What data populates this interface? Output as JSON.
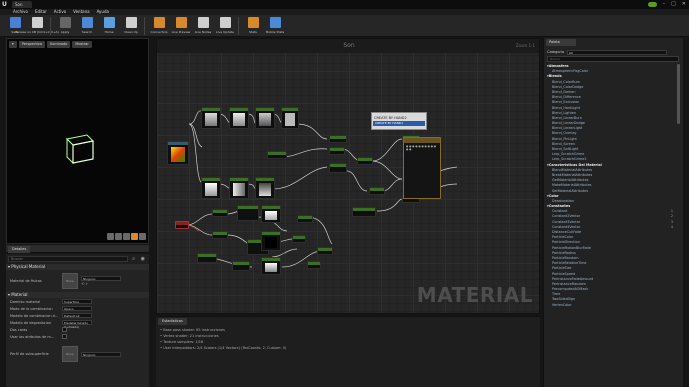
{
  "titlebar": {
    "tab": "Son"
  },
  "menu": [
    "Archivo",
    "Editar",
    "Activo",
    "Ventana",
    "Ayuda"
  ],
  "toolbar": [
    {
      "label": "Save",
      "color": "#4a7fd8",
      "active": false
    },
    {
      "label": "Browse on CB (Cmd+Ctrl+A)",
      "color": "#cfcfcf",
      "active": false
    },
    {
      "label": "Apply",
      "color": "#666666",
      "active": false
    },
    {
      "label": "Search",
      "color": "#4a8ad8",
      "active": false
    },
    {
      "label": "Home",
      "color": "#5aa0e0",
      "active": false
    },
    {
      "label": "Clean Up",
      "color": "#cfcfcf",
      "active": false
    },
    {
      "label": "Connectors",
      "color": "#d88a2a",
      "active": true
    },
    {
      "label": "Live Preview",
      "color": "#d88a2a",
      "active": true
    },
    {
      "label": "Live Nodes",
      "color": "#cfcfcf",
      "active": false
    },
    {
      "label": "Live Update",
      "color": "#cfcfcf",
      "active": false
    },
    {
      "label": "Stats",
      "color": "#d88a2a",
      "active": true
    },
    {
      "label": "Mobile Stats",
      "color": "#4a8ad8",
      "active": false
    }
  ],
  "viewport": {
    "buttons": [
      "Perspectiva",
      "Iluminado",
      "Mostrar"
    ]
  },
  "details": {
    "tab": "Detalles",
    "search_placeholder": "Buscar",
    "physical_section": "Physical Material",
    "phys_label": "Material de fisicas",
    "phys_thumb": "None",
    "phys_value": "Ninguno",
    "material_section": "Material",
    "rows": [
      {
        "label": "Dominio material",
        "value": "Superficie",
        "type": "dropdown"
      },
      {
        "label": "Modo de la combinacion",
        "value": "Opaco",
        "type": "dropdown"
      },
      {
        "label": "Modelo de combinacion d...",
        "value": "Default Lit",
        "type": "dropdown"
      },
      {
        "label": "Modelo de degradacion",
        "value": "Predeterminado (Lumiado)",
        "type": "dropdown"
      },
      {
        "label": "Dos caras",
        "value": "",
        "type": "checkbox"
      },
      {
        "label": "Usar los atributos de m...",
        "value": "",
        "type": "checkbox"
      }
    ],
    "subsurface_label": "Perfil de subsuperficie",
    "subsurface_thumb": "None",
    "subsurface_value": "Ninguno"
  },
  "graph": {
    "title": "Son",
    "zoom": "Zoom 1:1",
    "watermark": "MATERIAL"
  },
  "context_menu": {
    "item": "CREATE BY HAND2",
    "highlight": "CREATE BY HAND1"
  },
  "stats": {
    "tab": "Estadisticas",
    "lines": [
      "Base pass shader: 65 instrucciones",
      "Vertex shader: 21 instrucciones",
      "Texture samplers: 1/16",
      "User interpolators: 2/4 Scalars (1/4 Vectors) (TexCoords: 2, Custom: 0)"
    ]
  },
  "palette": {
    "tab": "Paleta",
    "category_label": "Categoria",
    "category_value": "All",
    "search_placeholder": "Buscar",
    "items": [
      {
        "text": "Atmosfera",
        "kind": "cat",
        "n": ""
      },
      {
        "text": "AtmosphericFogColor",
        "kind": "item",
        "n": ""
      },
      {
        "text": "Blends",
        "kind": "cat",
        "n": ""
      },
      {
        "text": "Blend_ColorBurn",
        "kind": "item",
        "n": ""
      },
      {
        "text": "Blend_ColorDodge",
        "kind": "item",
        "n": ""
      },
      {
        "text": "Blend_Darken",
        "kind": "item",
        "n": ""
      },
      {
        "text": "Blend_Difference",
        "kind": "item",
        "n": ""
      },
      {
        "text": "Blend_Exclusion",
        "kind": "item",
        "n": ""
      },
      {
        "text": "Blend_HardLight",
        "kind": "item",
        "n": ""
      },
      {
        "text": "Blend_Lighten",
        "kind": "item",
        "n": ""
      },
      {
        "text": "Blend_LinearBurn",
        "kind": "item",
        "n": ""
      },
      {
        "text": "Blend_LinearDodge",
        "kind": "item",
        "n": ""
      },
      {
        "text": "Blend_LinearLight",
        "kind": "item",
        "n": ""
      },
      {
        "text": "Blend_Overlay",
        "kind": "item",
        "n": ""
      },
      {
        "text": "Blend_PinLight",
        "kind": "item",
        "n": ""
      },
      {
        "text": "Blend_Screen",
        "kind": "item",
        "n": ""
      },
      {
        "text": "Blend_SoftLight",
        "kind": "item",
        "n": ""
      },
      {
        "text": "Lerp_ScratchGrime",
        "kind": "item",
        "n": ""
      },
      {
        "text": "Lerp_ScratchGrime2",
        "kind": "item",
        "n": ""
      },
      {
        "text": "Caracteristicas Del Material",
        "kind": "cat",
        "n": ""
      },
      {
        "text": "BlendMaterialAttributes",
        "kind": "item",
        "n": ""
      },
      {
        "text": "BreakMaterialAttributes",
        "kind": "item",
        "n": ""
      },
      {
        "text": "GetMaterialAttributes",
        "kind": "item",
        "n": ""
      },
      {
        "text": "MakeMaterialAttributes",
        "kind": "item",
        "n": ""
      },
      {
        "text": "SetMaterialAttributes",
        "kind": "item",
        "n": ""
      },
      {
        "text": "Color",
        "kind": "cat",
        "n": ""
      },
      {
        "text": "Desaturation",
        "kind": "item",
        "n": ""
      },
      {
        "text": "Constantes",
        "kind": "cat",
        "n": ""
      },
      {
        "text": "Constant",
        "kind": "item",
        "n": "1"
      },
      {
        "text": "Constant2Vector",
        "kind": "item",
        "n": "2"
      },
      {
        "text": "Constant3Vector",
        "kind": "item",
        "n": "3"
      },
      {
        "text": "Constant4Vector",
        "kind": "item",
        "n": "4"
      },
      {
        "text": "DistanceCullFade",
        "kind": "item",
        "n": ""
      },
      {
        "text": "ParticleColor",
        "kind": "item",
        "n": ""
      },
      {
        "text": "ParticleDirection",
        "kind": "item",
        "n": ""
      },
      {
        "text": "ParticleMotionBlurFade",
        "kind": "item",
        "n": ""
      },
      {
        "text": "ParticleRadius",
        "kind": "item",
        "n": ""
      },
      {
        "text": "ParticleRandom",
        "kind": "item",
        "n": ""
      },
      {
        "text": "ParticleRelativeTime",
        "kind": "item",
        "n": ""
      },
      {
        "text": "ParticleSize",
        "kind": "item",
        "n": ""
      },
      {
        "text": "ParticleSpeed",
        "kind": "item",
        "n": ""
      },
      {
        "text": "PerInstanceFadeAmount",
        "kind": "item",
        "n": ""
      },
      {
        "text": "PerInstanceRandom",
        "kind": "item",
        "n": ""
      },
      {
        "text": "PrecomputedAOMask",
        "kind": "item",
        "n": ""
      },
      {
        "text": "Time",
        "kind": "item",
        "n": ""
      },
      {
        "text": "TwoSidedSign",
        "kind": "item",
        "n": ""
      },
      {
        "text": "VertexColor",
        "kind": "item",
        "n": ""
      }
    ]
  },
  "colors": {
    "accent": "#d88a2a",
    "selection": "#2f5f8f",
    "node_header": "#3e6d24"
  }
}
